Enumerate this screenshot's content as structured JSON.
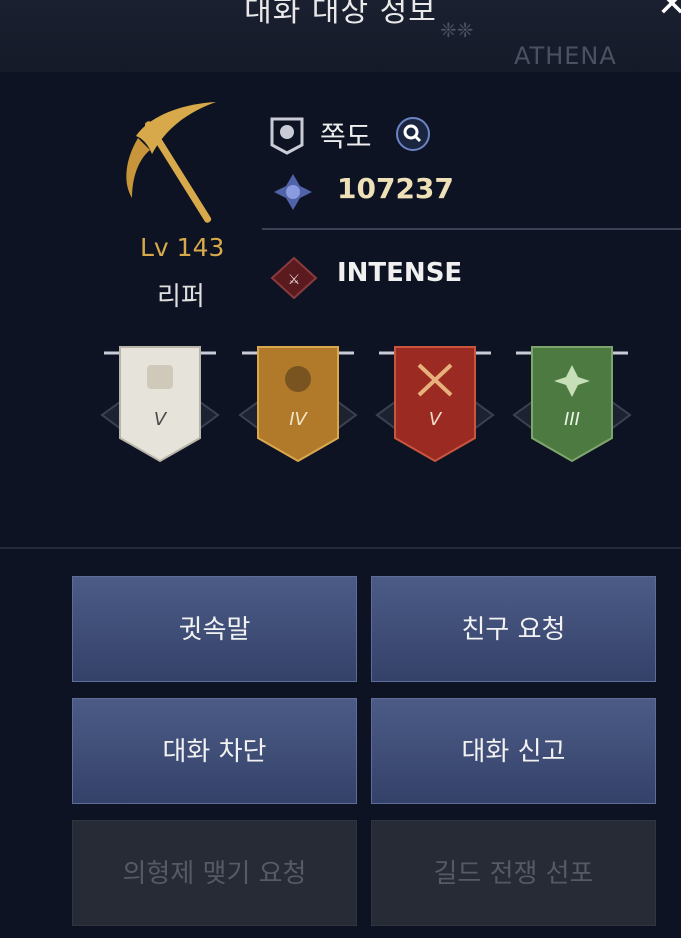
{
  "header": {
    "title": "대화 대상 정보",
    "watermark": "ATHENA"
  },
  "profile": {
    "level": "Lv 143",
    "class_name": "리퍼",
    "name": "쪽도",
    "power": "107237",
    "guild": "INTENSE"
  },
  "banners": [
    {
      "numeral": "V",
      "icon": "book-icon"
    },
    {
      "numeral": "IV",
      "icon": "mask-icon"
    },
    {
      "numeral": "V",
      "icon": "crossed-swords-icon"
    },
    {
      "numeral": "III",
      "icon": "emblem-icon"
    }
  ],
  "actions": {
    "whisper": "귓속말",
    "friend_request": "친구 요청",
    "block_chat": "대화 차단",
    "report_chat": "대화 신고",
    "brotherhood_request": "의형제 맺기 요청",
    "guild_war": "길드 전쟁 선포"
  },
  "colors": {
    "accent_gold": "#d7a94a",
    "button_blue": "#3f4d78"
  }
}
